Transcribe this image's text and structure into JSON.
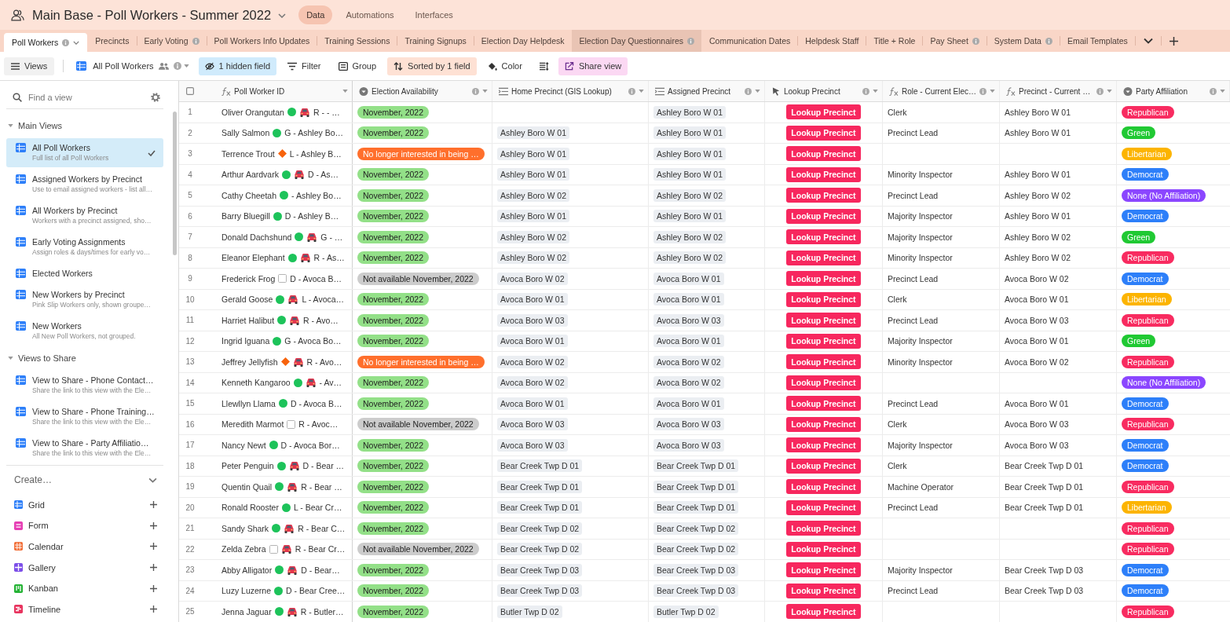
{
  "base": {
    "title": "Main Base - Poll Workers - Summer 2022",
    "nav": [
      {
        "label": "Data",
        "selected": true
      },
      {
        "label": "Automations",
        "selected": false
      },
      {
        "label": "Interfaces",
        "selected": false
      }
    ]
  },
  "tables": [
    {
      "label": "Poll Workers",
      "selected": true,
      "hovered": false,
      "info": true
    },
    {
      "label": "Precincts",
      "selected": false,
      "hovered": false,
      "info": false
    },
    {
      "label": "Early Voting",
      "selected": false,
      "hovered": false,
      "info": true
    },
    {
      "label": "Poll Workers Info Updates",
      "selected": false,
      "hovered": false,
      "info": false
    },
    {
      "label": "Training Sessions",
      "selected": false,
      "hovered": false,
      "info": false
    },
    {
      "label": "Training Signups",
      "selected": false,
      "hovered": false,
      "info": false
    },
    {
      "label": "Election Day Helpdesk",
      "selected": false,
      "hovered": false,
      "info": false
    },
    {
      "label": "Election Day Questionnaires",
      "selected": false,
      "hovered": true,
      "info": true
    },
    {
      "label": "Communication Dates",
      "selected": false,
      "hovered": false,
      "info": false
    },
    {
      "label": "Helpdesk Staff",
      "selected": false,
      "hovered": false,
      "info": false
    },
    {
      "label": "Title + Role",
      "selected": false,
      "hovered": false,
      "info": false
    },
    {
      "label": "Pay Sheet",
      "selected": false,
      "hovered": false,
      "info": true
    },
    {
      "label": "System Data",
      "selected": false,
      "hovered": false,
      "info": true
    },
    {
      "label": "Email Templates",
      "selected": false,
      "hovered": false,
      "info": false
    }
  ],
  "toolbar": {
    "views_label": "Views",
    "view_name": "All Poll Workers",
    "items": [
      {
        "kind": "hide",
        "label": "1 hidden field",
        "active": true
      },
      {
        "kind": "filter",
        "label": "Filter",
        "active": false
      },
      {
        "kind": "group",
        "label": "Group",
        "active": false
      },
      {
        "kind": "sort",
        "label": "Sorted by 1 field",
        "active": true
      },
      {
        "kind": "color",
        "label": "Color",
        "active": false
      },
      {
        "kind": "row_height"
      },
      {
        "kind": "share",
        "label": "Share view",
        "active": true
      }
    ]
  },
  "sidebar": {
    "search_placeholder": "Find a view",
    "sections": [
      {
        "title": "Main Views",
        "expanded": true,
        "views": [
          {
            "title": "All Poll Workers",
            "description": "Full list of all Poll Workers",
            "selected": true
          },
          {
            "title": "Assigned Workers by Precinct",
            "description": "Use to email assigned workers - list all…",
            "selected": false
          },
          {
            "title": "All Workers by Precinct",
            "description": "Workers with a precinct assigned, sho…",
            "selected": false
          },
          {
            "title": "Early Voting Assignments",
            "description": "Assign roles & days/times for early vo…",
            "selected": false
          },
          {
            "title": "Elected Workers",
            "selected": false
          },
          {
            "title": "New Workers by Precinct",
            "description": "Pink Slip Workers only, shown groupe…",
            "selected": false
          },
          {
            "title": "New Workers",
            "description": "All New Poll Workers, not grouped.",
            "selected": false
          }
        ]
      },
      {
        "title": "Views to Share",
        "expanded": true,
        "views": [
          {
            "title": "View to Share - Phone Contact…",
            "description": "Share the link to this view with the Ele…",
            "selected": false
          },
          {
            "title": "View to Share - Phone Training…",
            "description": "Share the link to this view with the Ele…",
            "selected": false
          },
          {
            "title": "View to Share - Party Affiliatio…",
            "description": "Share the link to this view with the Ele…",
            "selected": false
          }
        ]
      }
    ],
    "create": {
      "label": "Create…",
      "items": [
        {
          "kind": "grid",
          "label": "Grid"
        },
        {
          "kind": "form",
          "label": "Form"
        },
        {
          "kind": "calendar",
          "label": "Calendar"
        },
        {
          "kind": "gallery",
          "label": "Gallery"
        },
        {
          "kind": "kanban",
          "label": "Kanban"
        },
        {
          "kind": "timeline",
          "label": "Timeline"
        }
      ]
    }
  },
  "table": {
    "select_all": {
      "checked": false
    },
    "columns": [
      {
        "kind": "formula",
        "label": "Poll Worker ID",
        "info": false
      },
      {
        "kind": "select",
        "label": "Election Availability",
        "info": true
      },
      {
        "kind": "lookup",
        "label": "Home Precinct (GIS Lookup)",
        "info": true
      },
      {
        "kind": "lookup",
        "label": "Assigned Precinct",
        "info": true
      },
      {
        "kind": "button",
        "label": "Lookup Precinct",
        "info": true
      },
      {
        "kind": "formula",
        "label": "Role - Current Elec…",
        "info": true
      },
      {
        "kind": "formula",
        "label": "Precinct - Current …",
        "info": true
      },
      {
        "kind": "select",
        "label": "Party Affiliation",
        "info": true
      }
    ],
    "rows": [
      {
        "number": "1",
        "worker": {
          "name": "Oliver Orangutan",
          "marker": {
            "kind": "circle"
          },
          "car": true,
          "code": "R - - …"
        },
        "availability": {
          "label": "November, 2022",
          "color": "#93e088"
        },
        "assigned_precinct": "Ashley Boro W 01",
        "lookup_button": "Lookup Precinct",
        "role": "Clerk",
        "current_precinct": "Ashley Boro W 01",
        "party": {
          "label": "Republican",
          "color": "#f82b60"
        }
      },
      {
        "number": "2",
        "worker": {
          "name": "Sally Salmon",
          "marker": {
            "kind": "circle"
          },
          "car": false,
          "code": "G - Ashley Bo…"
        },
        "availability": {
          "label": "November, 2022",
          "color": "#93e088"
        },
        "home_precinct": "Ashley Boro W 01",
        "assigned_precinct": "Ashley Boro W 01",
        "lookup_button": "Lookup Precinct",
        "role": "Precinct Lead",
        "current_precinct": "Ashley Boro W 01",
        "party": {
          "label": "Green",
          "color": "#20c933"
        }
      },
      {
        "number": "3",
        "worker": {
          "name": "Terrence Trout",
          "marker": {
            "kind": "diamond"
          },
          "car": false,
          "code": "L - Ashley B…"
        },
        "availability": {
          "label": "No longer interested in being …",
          "color": "#ff6f2c"
        },
        "home_precinct": "Ashley Boro W 01",
        "assigned_precinct": "Ashley Boro W 01",
        "lookup_button": "Lookup Precinct",
        "party": {
          "label": "Libertarian",
          "color": "#fcb400"
        }
      },
      {
        "number": "4",
        "worker": {
          "name": "Arthur Aardvark",
          "marker": {
            "kind": "circle"
          },
          "car": true,
          "code": "D - As…"
        },
        "availability": {
          "label": "November, 2022",
          "color": "#93e088"
        },
        "home_precinct": "Ashley Boro W 01",
        "assigned_precinct": "Ashley Boro W 01",
        "lookup_button": "Lookup Precinct",
        "role": "Minority Inspector",
        "current_precinct": "Ashley Boro W 01",
        "party": {
          "label": "Democrat",
          "color": "#2d7ff9"
        }
      },
      {
        "number": "5",
        "worker": {
          "name": "Cathy Cheetah",
          "marker": {
            "kind": "circle"
          },
          "car": false,
          "code": "- Ashley Bo…"
        },
        "availability": {
          "label": "November, 2022",
          "color": "#93e088"
        },
        "home_precinct": "Ashley Boro W 02",
        "assigned_precinct": "Ashley Boro W 02",
        "lookup_button": "Lookup Precinct",
        "role": "Precinct Lead",
        "current_precinct": "Ashley Boro W 02",
        "party": {
          "label": "None (No Affiliation)",
          "color": "#8b46ff"
        }
      },
      {
        "number": "6",
        "worker": {
          "name": "Barry Bluegill",
          "marker": {
            "kind": "circle"
          },
          "car": false,
          "code": "D - Ashley B…"
        },
        "availability": {
          "label": "November, 2022",
          "color": "#93e088"
        },
        "home_precinct": "Ashley Boro W 01",
        "assigned_precinct": "Ashley Boro W 01",
        "lookup_button": "Lookup Precinct",
        "role": "Majority Inspector",
        "current_precinct": "Ashley Boro W 01",
        "party": {
          "label": "Democrat",
          "color": "#2d7ff9"
        }
      },
      {
        "number": "7",
        "worker": {
          "name": "Donald Dachshund",
          "marker": {
            "kind": "circle"
          },
          "car": true,
          "code": "G - …"
        },
        "availability": {
          "label": "November, 2022",
          "color": "#93e088"
        },
        "home_precinct": "Ashley Boro W 02",
        "assigned_precinct": "Ashley Boro W 02",
        "lookup_button": "Lookup Precinct",
        "role": "Majority Inspector",
        "current_precinct": "Ashley Boro W 02",
        "party": {
          "label": "Green",
          "color": "#20c933"
        }
      },
      {
        "number": "8",
        "worker": {
          "name": "Eleanor Elephant",
          "marker": {
            "kind": "circle"
          },
          "car": true,
          "code": "R - As…"
        },
        "availability": {
          "label": "November, 2022",
          "color": "#93e088"
        },
        "home_precinct": "Ashley Boro W 02",
        "assigned_precinct": "Ashley Boro W 02",
        "lookup_button": "Lookup Precinct",
        "role": "Minority Inspector",
        "current_precinct": "Ashley Boro W 02",
        "party": {
          "label": "Republican",
          "color": "#f82b60"
        }
      },
      {
        "number": "9",
        "worker": {
          "name": "Frederick Frog",
          "marker": {
            "kind": "square"
          },
          "car": false,
          "code": "D - Avoca B…"
        },
        "availability": {
          "label": "Not available November, 2022",
          "color": "#cccccc"
        },
        "home_precinct": "Avoca Boro W 02",
        "assigned_precinct": "Avoca Boro W 01",
        "lookup_button": "Lookup Precinct",
        "role": "Precinct Lead",
        "current_precinct": "Avoca Boro W 02",
        "party": {
          "label": "Democrat",
          "color": "#2d7ff9"
        }
      },
      {
        "number": "10",
        "worker": {
          "name": "Gerald Goose",
          "marker": {
            "kind": "circle"
          },
          "car": true,
          "code": "L - Avoca…"
        },
        "availability": {
          "label": "November, 2022",
          "color": "#93e088"
        },
        "home_precinct": "Avoca Boro W 01",
        "assigned_precinct": "Avoca Boro W 01",
        "lookup_button": "Lookup Precinct",
        "role": "Clerk",
        "current_precinct": "Avoca Boro W 01",
        "party": {
          "label": "Libertarian",
          "color": "#fcb400"
        }
      },
      {
        "number": "11",
        "worker": {
          "name": "Harriet Halibut",
          "marker": {
            "kind": "circle"
          },
          "car": true,
          "code": "R - Avo…"
        },
        "availability": {
          "label": "November, 2022",
          "color": "#93e088"
        },
        "home_precinct": "Avoca Boro W 03",
        "assigned_precinct": "Avoca Boro W 03",
        "lookup_button": "Lookup Precinct",
        "role": "Precinct Lead",
        "current_precinct": "Avoca Boro W 03",
        "party": {
          "label": "Republican",
          "color": "#f82b60"
        }
      },
      {
        "number": "12",
        "worker": {
          "name": "Ingrid Iguana",
          "marker": {
            "kind": "circle"
          },
          "car": false,
          "code": "G - Avoca Bo…"
        },
        "availability": {
          "label": "November, 2022",
          "color": "#93e088"
        },
        "home_precinct": "Avoca Boro W 01",
        "assigned_precinct": "Avoca Boro W 01",
        "lookup_button": "Lookup Precinct",
        "role": "Majority Inspector",
        "current_precinct": "Avoca Boro W 01",
        "party": {
          "label": "Green",
          "color": "#20c933"
        }
      },
      {
        "number": "13",
        "worker": {
          "name": "Jeffrey Jellyfish",
          "marker": {
            "kind": "diamond"
          },
          "car": true,
          "code": "R - Avo…"
        },
        "availability": {
          "label": "No longer interested in being …",
          "color": "#ff6f2c"
        },
        "home_precinct": "Avoca Boro W 02",
        "assigned_precinct": "Avoca Boro W 02",
        "lookup_button": "Lookup Precinct",
        "role": "Minority Inspector",
        "current_precinct": "Avoca Boro W 02",
        "party": {
          "label": "Republican",
          "color": "#f82b60"
        }
      },
      {
        "number": "14",
        "worker": {
          "name": "Kenneth Kangaroo",
          "marker": {
            "kind": "circle"
          },
          "car": true,
          "code": "- Av…"
        },
        "availability": {
          "label": "November, 2022",
          "color": "#93e088"
        },
        "home_precinct": "Avoca Boro W 02",
        "assigned_precinct": "Avoca Boro W 02",
        "lookup_button": "Lookup Precinct",
        "party": {
          "label": "None (No Affiliation)",
          "color": "#8b46ff"
        }
      },
      {
        "number": "15",
        "worker": {
          "name": "Llewllyn Llama",
          "marker": {
            "kind": "circle"
          },
          "car": false,
          "code": "D - Avoca B…"
        },
        "availability": {
          "label": "November, 2022",
          "color": "#93e088"
        },
        "home_precinct": "Avoca Boro W 01",
        "assigned_precinct": "Avoca Boro W 01",
        "lookup_button": "Lookup Precinct",
        "role": "Precinct Lead",
        "current_precinct": "Avoca Boro W 01",
        "party": {
          "label": "Democrat",
          "color": "#2d7ff9"
        }
      },
      {
        "number": "16",
        "worker": {
          "name": "Meredith Marmot",
          "marker": {
            "kind": "square"
          },
          "car": false,
          "code": "R - Avoc…"
        },
        "availability": {
          "label": "Not available November, 2022",
          "color": "#cccccc"
        },
        "home_precinct": "Avoca Boro W 03",
        "assigned_precinct": "Avoca Boro W 03",
        "lookup_button": "Lookup Precinct",
        "role": "Clerk",
        "current_precinct": "Avoca Boro W 03",
        "party": {
          "label": "Republican",
          "color": "#f82b60"
        }
      },
      {
        "number": "17",
        "worker": {
          "name": "Nancy Newt",
          "marker": {
            "kind": "circle"
          },
          "car": false,
          "code": "D - Avoca Bor…"
        },
        "availability": {
          "label": "November, 2022",
          "color": "#93e088"
        },
        "home_precinct": "Avoca Boro W 03",
        "assigned_precinct": "Avoca Boro W 03",
        "lookup_button": "Lookup Precinct",
        "role": "Majority Inspector",
        "current_precinct": "Avoca Boro W 03",
        "party": {
          "label": "Democrat",
          "color": "#2d7ff9"
        }
      },
      {
        "number": "18",
        "worker": {
          "name": "Peter Penguin",
          "marker": {
            "kind": "circle"
          },
          "car": true,
          "code": "D - Bear …"
        },
        "availability": {
          "label": "November, 2022",
          "color": "#93e088"
        },
        "home_precinct": "Bear Creek Twp D 01",
        "assigned_precinct": "Bear Creek Twp D 01",
        "lookup_button": "Lookup Precinct",
        "role": "Clerk",
        "current_precinct": "Bear Creek Twp D 01",
        "party": {
          "label": "Democrat",
          "color": "#2d7ff9"
        }
      },
      {
        "number": "19",
        "worker": {
          "name": "Quentin Quail",
          "marker": {
            "kind": "circle"
          },
          "car": true,
          "code": "R - Bear …"
        },
        "availability": {
          "label": "November, 2022",
          "color": "#93e088"
        },
        "home_precinct": "Bear Creek Twp D 01",
        "assigned_precinct": "Bear Creek Twp D 01",
        "lookup_button": "Lookup Precinct",
        "role": "Machine Operator",
        "current_precinct": "Bear Creek Twp D 01",
        "party": {
          "label": "Republican",
          "color": "#f82b60"
        }
      },
      {
        "number": "20",
        "worker": {
          "name": "Ronald Rooster",
          "marker": {
            "kind": "circle"
          },
          "car": false,
          "code": "L - Bear Cr…"
        },
        "availability": {
          "label": "November, 2022",
          "color": "#93e088"
        },
        "home_precinct": "Bear Creek Twp D 01",
        "assigned_precinct": "Bear Creek Twp D 01",
        "lookup_button": "Lookup Precinct",
        "role": "Precinct Lead",
        "current_precinct": "Bear Creek Twp D 01",
        "party": {
          "label": "Libertarian",
          "color": "#fcb400"
        }
      },
      {
        "number": "21",
        "worker": {
          "name": "Sandy Shark",
          "marker": {
            "kind": "circle"
          },
          "car": true,
          "code": "R - Bear C…"
        },
        "availability": {
          "label": "November, 2022",
          "color": "#93e088"
        },
        "home_precinct": "Bear Creek Twp D 02",
        "assigned_precinct": "Bear Creek Twp D 02",
        "lookup_button": "Lookup Precinct",
        "party": {
          "label": "Republican",
          "color": "#f82b60"
        }
      },
      {
        "number": "22",
        "worker": {
          "name": "Zelda Zebra",
          "marker": {
            "kind": "square"
          },
          "car": true,
          "code": "R - Bear Cr…"
        },
        "availability": {
          "label": "Not available November, 2022",
          "color": "#cccccc"
        },
        "home_precinct": "Bear Creek Twp D 02",
        "assigned_precinct": "Bear Creek Twp D 02",
        "lookup_button": "Lookup Precinct",
        "party": {
          "label": "Republican",
          "color": "#f82b60"
        }
      },
      {
        "number": "23",
        "worker": {
          "name": "Abby Alligator",
          "marker": {
            "kind": "circle"
          },
          "car": true,
          "code": "D - Bear…"
        },
        "availability": {
          "label": "November, 2022",
          "color": "#93e088"
        },
        "home_precinct": "Bear Creek Twp D 03",
        "assigned_precinct": "Bear Creek Twp D 03",
        "lookup_button": "Lookup Precinct",
        "role": "Majority Inspector",
        "current_precinct": "Bear Creek Twp D 03",
        "party": {
          "label": "Democrat",
          "color": "#2d7ff9"
        }
      },
      {
        "number": "24",
        "worker": {
          "name": "Luzy Luzerne",
          "marker": {
            "kind": "circle"
          },
          "car": false,
          "code": "D - Bear Cree…"
        },
        "availability": {
          "label": "November, 2022",
          "color": "#93e088"
        },
        "home_precinct": "Bear Creek Twp D 03",
        "assigned_precinct": "Bear Creek Twp D 03",
        "lookup_button": "Lookup Precinct",
        "role": "Precinct Lead",
        "current_precinct": "Bear Creek Twp D 03",
        "party": {
          "label": "Democrat",
          "color": "#2d7ff9"
        }
      },
      {
        "number": "25",
        "worker": {
          "name": "Jenna Jaguar",
          "marker": {
            "kind": "circle"
          },
          "car": true,
          "code": "R - Butler…"
        },
        "availability": {
          "label": "November, 2022",
          "color": "#93e088"
        },
        "home_precinct": "Butler Twp D 02",
        "assigned_precinct": "Butler Twp D 02",
        "lookup_button": "Lookup Precinct",
        "party": {
          "label": "Republican",
          "color": "#f82b60"
        }
      }
    ]
  }
}
